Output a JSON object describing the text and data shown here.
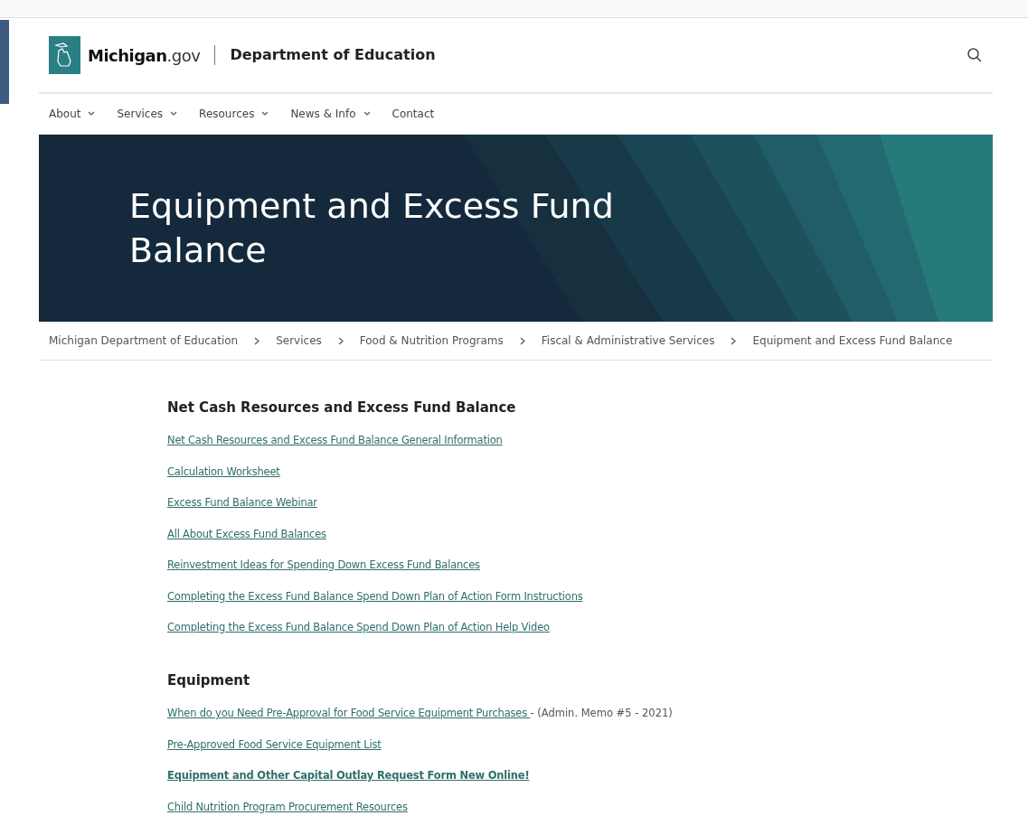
{
  "header": {
    "brand": "Michigan",
    "brand_suffix": ".gov",
    "department": "Department of Education"
  },
  "nav": [
    {
      "label": "About",
      "dropdown": true
    },
    {
      "label": "Services",
      "dropdown": true
    },
    {
      "label": "Resources",
      "dropdown": true
    },
    {
      "label": "News & Info",
      "dropdown": true
    },
    {
      "label": "Contact",
      "dropdown": false
    }
  ],
  "hero": {
    "title": "Equipment and Excess Fund Balance"
  },
  "breadcrumb": [
    "Michigan Department of Education",
    "Services",
    "Food & Nutrition Programs",
    "Fiscal & Administrative Services",
    "Equipment and Excess Fund Balance"
  ],
  "sections": [
    {
      "heading": "Net Cash Resources and Excess Fund Balance",
      "links": [
        {
          "label": "Net Cash Resources and Excess Fund Balance General Information",
          "bold": false
        },
        {
          "label": "Calculation Worksheet",
          "bold": false
        },
        {
          "label": "Excess Fund Balance Webinar",
          "bold": false
        },
        {
          "label": "All About Excess Fund Balances",
          "bold": false
        },
        {
          "label": "Reinvestment Ideas for Spending Down Excess Fund Balances",
          "bold": false
        },
        {
          "label": "Completing the Excess Fund Balance Spend Down Plan of Action Form Instructions",
          "bold": false
        },
        {
          "label": "Completing the Excess Fund Balance Spend Down Plan of Action Help Video ",
          "bold": false
        }
      ]
    },
    {
      "heading": "Equipment",
      "links": [
        {
          "label": "When do you Need Pre-Approval for Food Service Equipment Purchases ",
          "bold": false,
          "note": "- (Admin. Memo #5 - 2021)"
        },
        {
          "label": "Pre-Approved Food Service Equipment List",
          "bold": false
        },
        {
          "label": "Equipment and Other Capital Outlay Request Form New Online!",
          "bold": true
        },
        {
          "label": "Child Nutrition Program Procurement Resources",
          "bold": false
        }
      ]
    }
  ]
}
